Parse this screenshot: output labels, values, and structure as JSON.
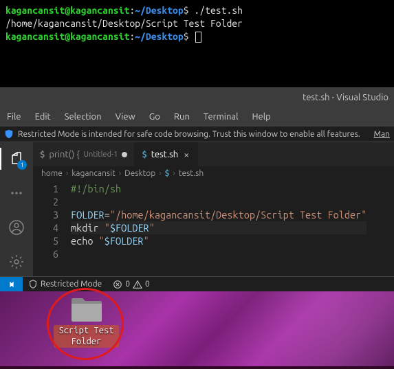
{
  "terminal": {
    "prompt_user": "kagancansit@kagancansit",
    "prompt_colon": ":",
    "prompt_path": "~/Desktop",
    "prompt_dollar": "$",
    "cmd1": "./test.sh",
    "output1": "/home/kagancansit/Desktop/Script Test Folder"
  },
  "vscode": {
    "title": "test.sh - Visual Studio",
    "menu": [
      "File",
      "Edit",
      "Selection",
      "View",
      "Go",
      "Run",
      "Terminal",
      "Help"
    ],
    "banner": {
      "text": "Restricted Mode is intended for safe code browsing. Trust this window to enable all features.",
      "action": "Man"
    },
    "activity_badge": "1",
    "tabs": [
      {
        "icon": "$",
        "label": "print() {",
        "sub": "Untitled-1",
        "dirty": true,
        "active": false
      },
      {
        "icon": "$",
        "label": "test.sh",
        "dirty": false,
        "active": true
      }
    ],
    "breadcrumb": [
      "home",
      "kagancansit",
      "Desktop",
      "$",
      "test.sh"
    ],
    "code": {
      "lines": [
        {
          "n": 1,
          "parts": [
            {
              "c": "c-com",
              "t": "#!/bin/sh"
            }
          ]
        },
        {
          "n": 2,
          "parts": []
        },
        {
          "n": 3,
          "parts": [
            {
              "c": "c-var",
              "t": "FOLDER"
            },
            {
              "c": "c-op",
              "t": "="
            },
            {
              "c": "c-str",
              "t": "\"/home/kagancansit/Desktop/Script Test Folder\""
            }
          ]
        },
        {
          "n": 4,
          "hl": true,
          "parts": [
            {
              "c": "c-cmd",
              "t": "mkdir "
            },
            {
              "c": "c-str",
              "t": "\""
            },
            {
              "c": "c-var",
              "t": "$FOLDER"
            },
            {
              "c": "c-str",
              "t": "\""
            }
          ]
        },
        {
          "n": 5,
          "parts": [
            {
              "c": "c-cmd",
              "t": "echo "
            },
            {
              "c": "c-str",
              "t": "\""
            },
            {
              "c": "c-var",
              "t": "$FOLDER"
            },
            {
              "c": "c-str",
              "t": "\""
            }
          ]
        },
        {
          "n": 6,
          "parts": []
        }
      ]
    },
    "status": {
      "restricted": "Restricted Mode",
      "errors": "0",
      "warnings": "0"
    }
  },
  "desktop": {
    "folder_label": "Script Test Folder"
  }
}
